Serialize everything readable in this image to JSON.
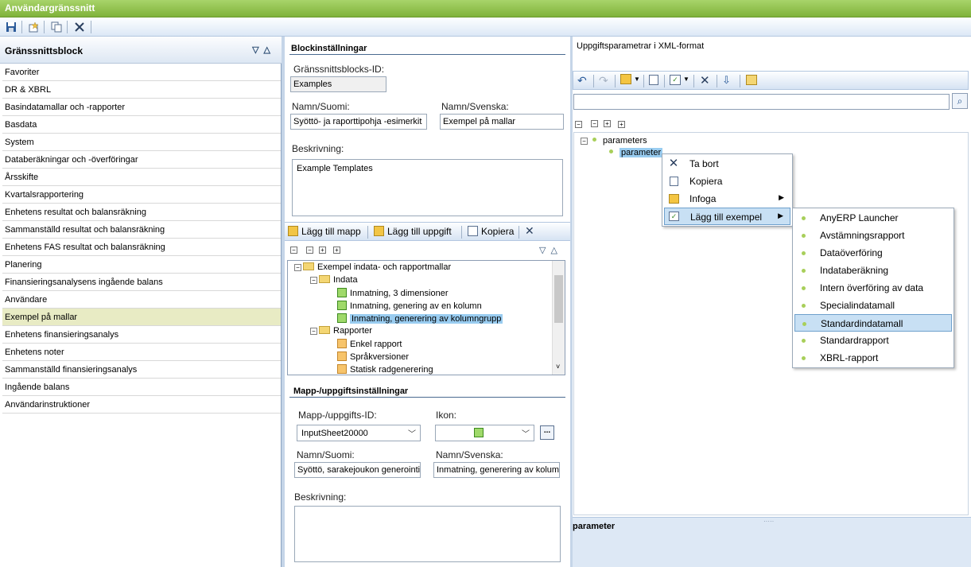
{
  "app": {
    "title": "Användargränssnitt"
  },
  "toolbar": {
    "icons": [
      "save-icon",
      "new-icon",
      "copy-icon",
      "delete-icon"
    ]
  },
  "left": {
    "header": "Gränssnittsblock",
    "items": [
      "Favoriter",
      "DR & XBRL",
      "Basindatamallar och -rapporter",
      "Basdata",
      "System",
      "Databeräkningar och -överföringar",
      "Årsskifte",
      "Kvartalsrapportering",
      "Enhetens resultat och balansräkning",
      "Sammanställd resultat och balansräkning",
      "Enhetens FAS resultat och balansräkning",
      "Planering",
      "Finansieringsanalysens ingående balans",
      "Användare",
      "Exempel på mallar",
      "Enhetens finansieringsanalys",
      "Enhetens noter",
      "Sammanställd finansieringsanalys",
      "Ingående balans",
      "Användarinstruktioner"
    ],
    "selected_index": 14
  },
  "block": {
    "section_title": "Blockinställningar",
    "id_label": "Gränssnittsblocks-ID:",
    "id_value": "Examples",
    "name_fi_label": "Namn/Suomi:",
    "name_fi_value": "Syöttö- ja raporttipohja -esimerkit",
    "name_sv_label": "Namn/Svenska:",
    "name_sv_value": "Exempel på mallar",
    "desc_label": "Beskrivning:",
    "desc_value": "Example Templates"
  },
  "mid_toolbar": {
    "add_folder": "Lägg till mapp",
    "add_task": "Lägg till uppgift",
    "copy": "Kopiera"
  },
  "tree": {
    "root": "Exempel indata- och rapportmallar",
    "indata": "Indata",
    "indata_items": [
      "Inmatning, 3 dimensioner",
      "Inmatning, genering av en kolumn",
      "Inmatning, generering av kolumngrupp"
    ],
    "rapporter": "Rapporter",
    "rapporter_items": [
      "Enkel rapport",
      "Språkversioner",
      "Statisk radgenerering"
    ]
  },
  "task": {
    "section_title": "Mapp-/uppgiftsinställningar",
    "id_label": "Mapp-/uppgifts-ID:",
    "id_value": "InputSheet20000",
    "icon_label": "Ikon:",
    "browse": "...",
    "name_fi_label": "Namn/Suomi:",
    "name_fi_value": "Syöttö, sarakejoukon generointi",
    "name_sv_label": "Namn/Svenska:",
    "name_sv_value": "Inmatning, generering av kolumngrupp",
    "desc_label": "Beskrivning:",
    "desc_value": ""
  },
  "right": {
    "title": "Uppgiftsparametrar i XML-format",
    "search_value": "",
    "tree_root": "parameters",
    "tree_child": "parameter",
    "status": "parameter"
  },
  "context_menu": {
    "items": [
      "Ta bort",
      "Kopiera",
      "Infoga",
      "Lägg till exempel"
    ],
    "icons": [
      "delete-icon",
      "copy-icon",
      "insert-icon",
      "add-example-icon"
    ]
  },
  "submenu": {
    "items": [
      "AnyERP Launcher",
      "Avstämningsrapport",
      "Dataöverföring",
      "Indataberäkning",
      "Intern överföring av data",
      "Specialindatamall",
      "Standardindatamall",
      "Standardrapport",
      "XBRL-rapport"
    ],
    "highlighted_index": 6
  }
}
